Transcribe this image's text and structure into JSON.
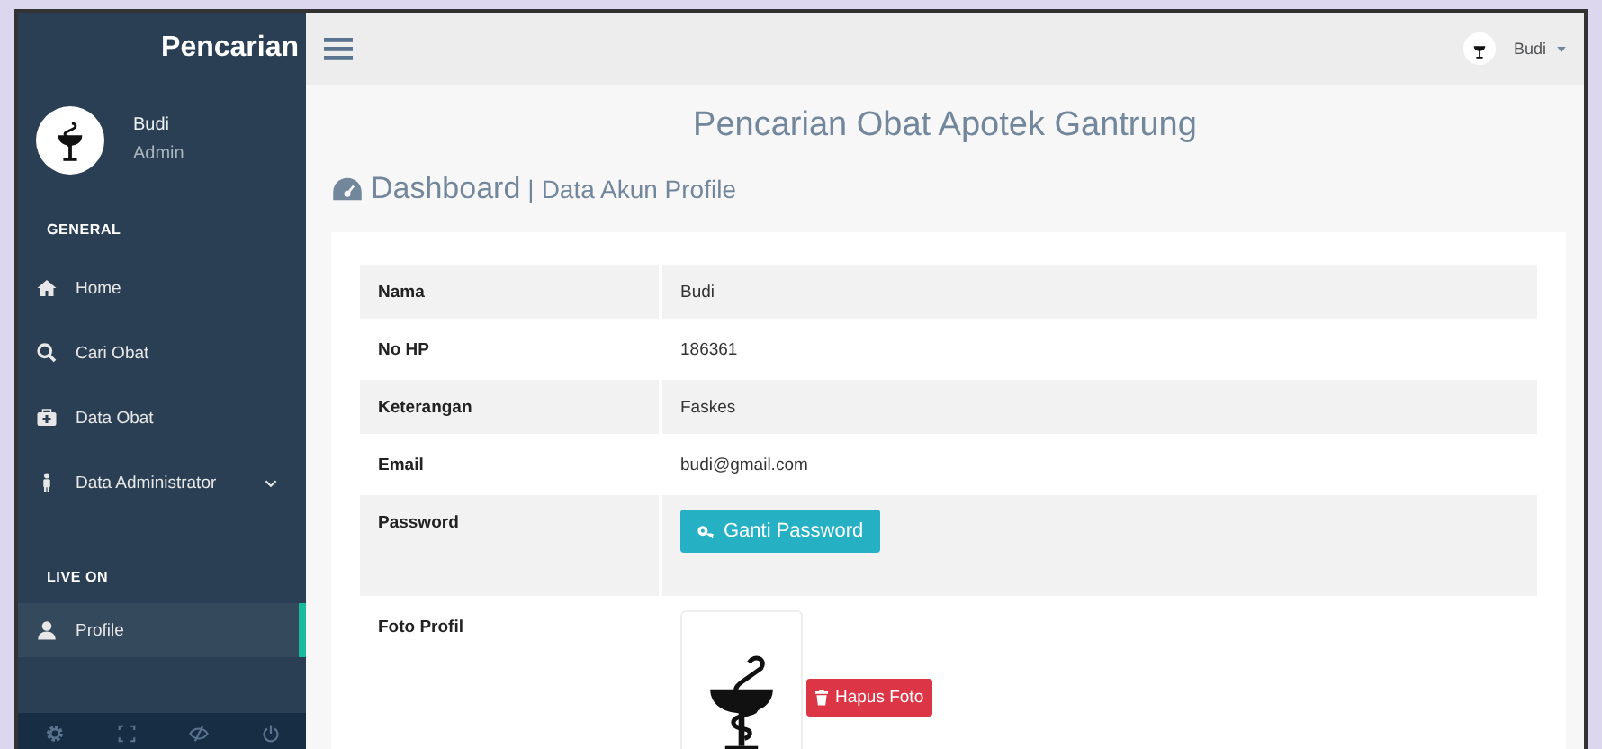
{
  "sidebar": {
    "brand": "Pencarian",
    "user": {
      "name": "Budi",
      "role": "Admin"
    },
    "sections": [
      {
        "title": "GENERAL",
        "items": [
          {
            "label": "Home",
            "selected": false,
            "expandable": false
          },
          {
            "label": "Cari Obat",
            "selected": false,
            "expandable": false
          },
          {
            "label": "Data Obat",
            "selected": false,
            "expandable": false
          },
          {
            "label": "Data Administrator",
            "selected": false,
            "expandable": true
          }
        ]
      },
      {
        "title": "LIVE ON",
        "items": [
          {
            "label": "Profile",
            "selected": true,
            "expandable": false
          }
        ]
      }
    ]
  },
  "topbar": {
    "user_name": "Budi"
  },
  "page_title": "Pencarian Obat Apotek Gantrung",
  "heading": {
    "title": "Dashboard",
    "separator": "|",
    "subtitle": "Data Akun Profile"
  },
  "profile_table": [
    {
      "kind": "text",
      "label": "Nama",
      "value": "Budi"
    },
    {
      "kind": "text",
      "label": "No HP",
      "value": "186361"
    },
    {
      "kind": "text",
      "label": "Keterangan",
      "value": "Faskes"
    },
    {
      "kind": "text",
      "label": "Email",
      "value": "budi@gmail.com"
    },
    {
      "kind": "button",
      "label": "Password",
      "button": "Ganti Password"
    },
    {
      "kind": "photo",
      "label": "Foto Profil",
      "button": "Hapus Foto"
    }
  ]
}
